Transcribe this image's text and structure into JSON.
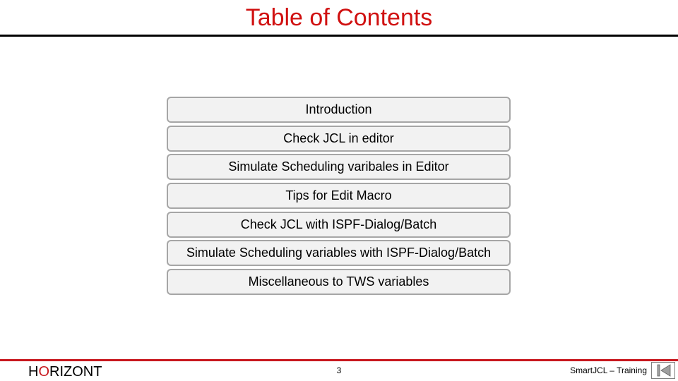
{
  "slide": {
    "title": "Table of Contents",
    "toc_items": [
      {
        "label": "Introduction"
      },
      {
        "label": "Check JCL in editor"
      },
      {
        "label": "Simulate Scheduling varibales in Editor"
      },
      {
        "label": "Tips for Edit Macro"
      },
      {
        "label": "Check JCL with ISPF-Dialog/Batch"
      },
      {
        "label": "Simulate Scheduling variables with ISPF-Dialog/Batch"
      },
      {
        "label": "Miscellaneous to TWS variables"
      }
    ]
  },
  "footer": {
    "logo_prefix": "H",
    "logo_accent": "O",
    "logo_suffix": "RIZONT",
    "page_number": "3",
    "course_label": "SmartJCL – Training",
    "nav_icon": "first-slide-icon"
  },
  "colors": {
    "title": "#d01010",
    "accent_red": "#c8181e",
    "box_fill": "#f2f2f2",
    "box_border": "#a6a6a6"
  }
}
